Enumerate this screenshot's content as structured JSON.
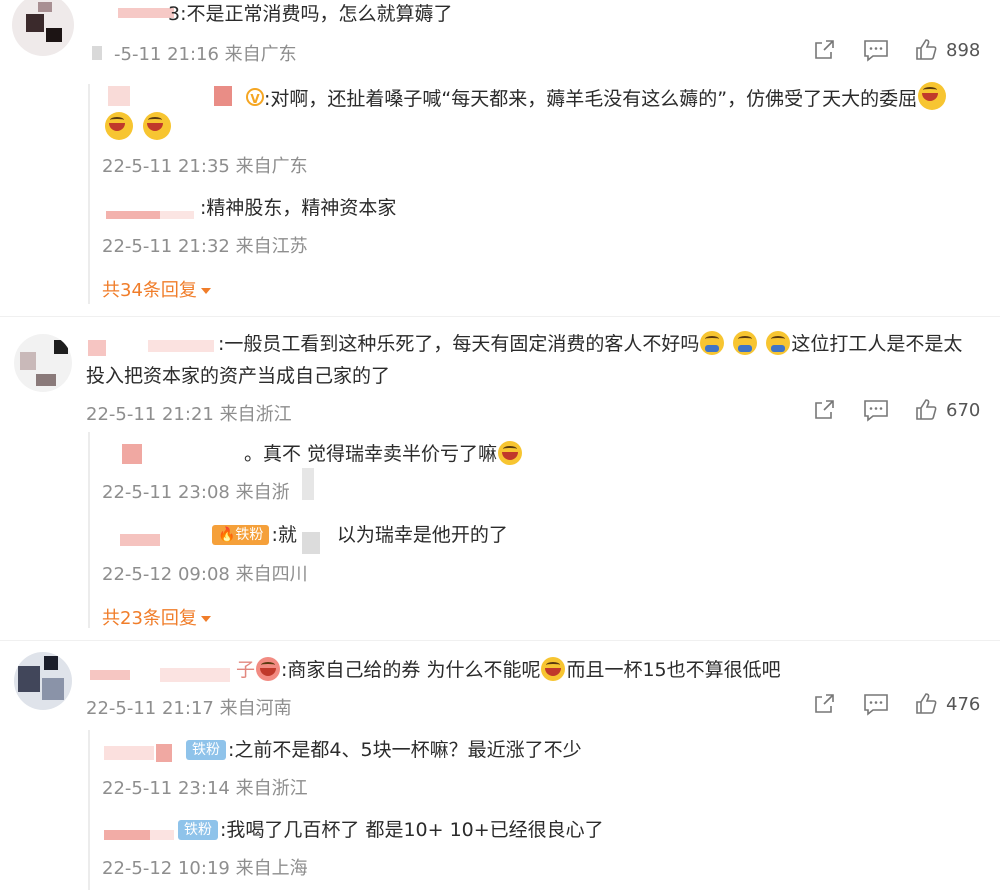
{
  "comments": [
    {
      "name_tail": "3",
      "text": ":不是正常消费吗，怎么就算薅了",
      "meta": "-5-11 21:16 来自广东",
      "likes": "898",
      "replies": [
        {
          "text": ":对啊，还扯着嗓子喊“每天都来，薅羊毛没有这么薅的”，仿佛受了天大的委屈",
          "meta": "22-5-11 21:35 来自广东"
        },
        {
          "text": ":精神股东，精神资本家",
          "meta": "22-5-11 21:32 来自江苏"
        }
      ],
      "more": "共34条回复"
    },
    {
      "text_line1": ":一般员工看到这种乐死了，每天有固定消费的客人不好吗",
      "text_line1b": "这位打工人是不是太",
      "text_line2": "投入把资本家的资产当成自己家的了",
      "meta": "22-5-11 21:21 来自浙江",
      "likes": "670",
      "replies": [
        {
          "prefix": "。真不",
          "text": "觉得瑞幸卖半价亏了嘛",
          "meta": "22-5-11 23:08 来自浙"
        },
        {
          "badge": "铁粉",
          "prefix": ":就",
          "text": "以为瑞幸是他开的了",
          "meta": "22-5-12 09:08 来自四川"
        }
      ],
      "more": "共23条回复"
    },
    {
      "name_tail": "子",
      "text_a": ":商家自己给的券 为什么不能呢",
      "text_b": "而且一杯15也不算很低吧",
      "meta": "22-5-11 21:17 来自河南",
      "likes": "476",
      "replies": [
        {
          "badge": "铁粉",
          "text": ":之前不是都4、5块一杯嘛？最近涨了不少",
          "meta": "22-5-11 23:14 来自浙江"
        },
        {
          "badge": "铁粉",
          "text": ":我喝了几百杯了 都是10+ 10+已经很良心了",
          "meta": "22-5-12 10:19 来自上海"
        }
      ]
    }
  ],
  "colors": {
    "accent": "#f07d2a",
    "meta": "#8e8e8e",
    "badge": "#8fc3ea"
  },
  "icons": [
    "share-icon",
    "comment-icon",
    "like-icon",
    "laugh-emoji",
    "grin-emoji"
  ]
}
